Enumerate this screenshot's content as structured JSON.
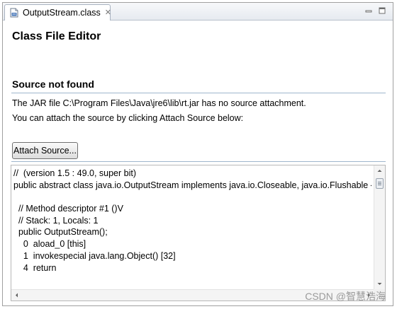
{
  "tab": {
    "title": "OutputStream.class",
    "icon": "class-file-icon",
    "close_icon": "close-icon"
  },
  "window_controls": {
    "minimize_icon": "minimize-icon",
    "maximize_icon": "maximize-icon"
  },
  "editor": {
    "title": "Class File Editor",
    "section_title": "Source not found",
    "message_line1": "The JAR file C:\\Program Files\\Java\\jre6\\lib\\rt.jar has no source attachment.",
    "message_line2": "You can attach the source by clicking Attach Source below:",
    "attach_button_label": "Attach Source..."
  },
  "code": {
    "lines": [
      "//  (version 1.5 : 49.0, super bit)",
      "public abstract class java.io.OutputStream implements java.io.Closeable, java.io.Flushable {",
      "",
      "  // Method descriptor #1 ()V",
      "  // Stack: 1, Locals: 1",
      "  public OutputStream();",
      "    0  aload_0 [this]",
      "    1  invokespecial java.lang.Object() [32]",
      "    4  return"
    ]
  },
  "watermark": "CSDN @智慧浩海",
  "colors": {
    "section_rule": "#9fb6cd",
    "tab_bar": "#e6eaf0"
  }
}
